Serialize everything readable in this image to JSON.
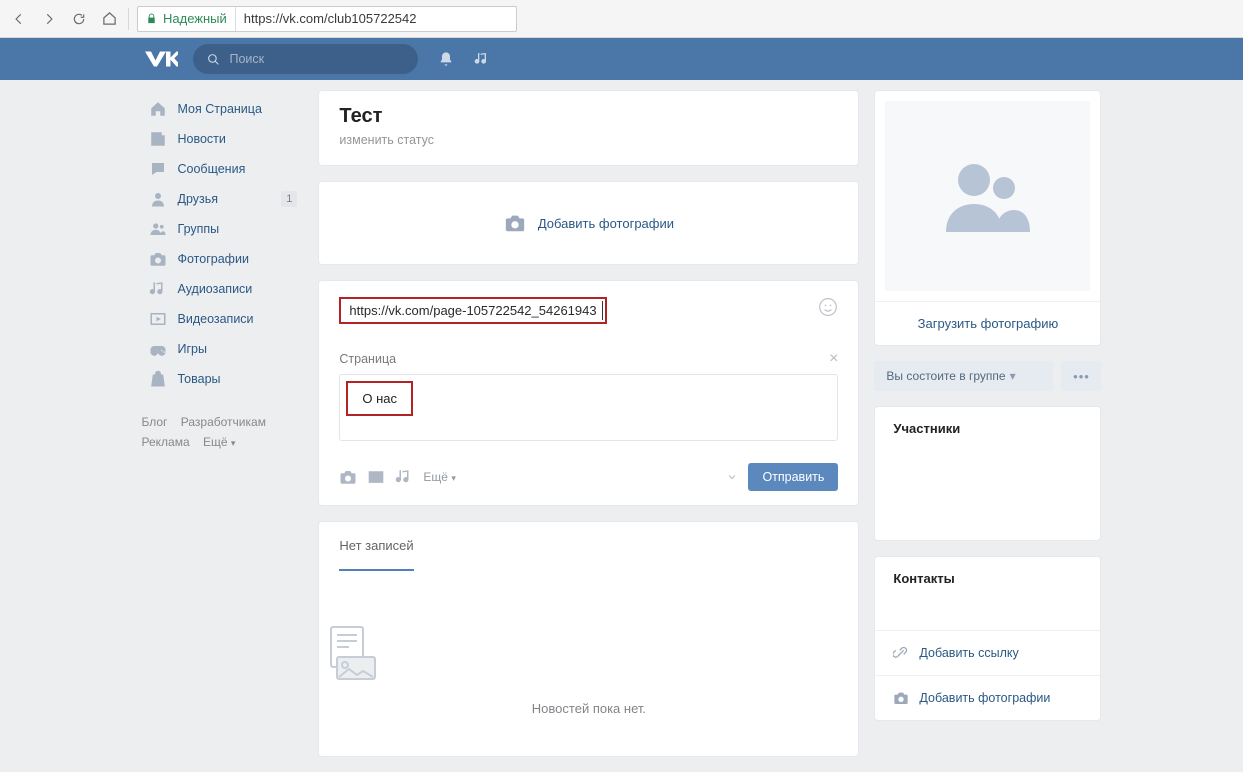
{
  "browser": {
    "secure_label": "Надежный",
    "url": "https://vk.com/club105722542"
  },
  "header": {
    "search_placeholder": "Поиск"
  },
  "nav": {
    "items": [
      {
        "label": "Моя Страница",
        "icon": "home"
      },
      {
        "label": "Новости",
        "icon": "news"
      },
      {
        "label": "Сообщения",
        "icon": "chat"
      },
      {
        "label": "Друзья",
        "icon": "user",
        "count": "1"
      },
      {
        "label": "Группы",
        "icon": "users"
      },
      {
        "label": "Фотографии",
        "icon": "camera"
      },
      {
        "label": "Аудиозаписи",
        "icon": "music"
      },
      {
        "label": "Видеозаписи",
        "icon": "video"
      },
      {
        "label": "Игры",
        "icon": "joystick"
      },
      {
        "label": "Товары",
        "icon": "bag"
      }
    ],
    "footer": {
      "blog": "Блог",
      "devs": "Разработчикам",
      "ads": "Реклама",
      "more": "Ещё"
    }
  },
  "group": {
    "title": "Тест",
    "change_status": "изменить статус"
  },
  "add_photos_label": "Добавить фотографии",
  "post": {
    "input_value": "https://vk.com/page-105722542_54261943",
    "attach_header": "Страница",
    "attach_label": "О нас",
    "more_label": "Ещё",
    "send_label": "Отправить"
  },
  "wall": {
    "tab_empty": "Нет записей",
    "empty_text": "Новостей пока нет."
  },
  "right": {
    "upload_label": "Загрузить фотографию",
    "member_label": "Вы состоите в группе",
    "participants_header": "Участники",
    "contacts_header": "Контакты",
    "add_link": "Добавить ссылку",
    "add_photos": "Добавить фотографии"
  }
}
